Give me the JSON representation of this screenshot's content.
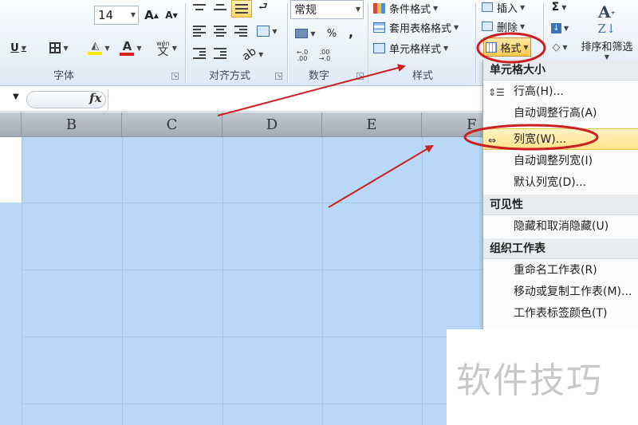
{
  "ribbon": {
    "font": {
      "size_value": "14",
      "increase_size": "A",
      "decrease_size": "A",
      "underline": "U",
      "font_color_letter": "A",
      "phonetic": "wén",
      "group_label": "字体"
    },
    "alignment": {
      "group_label": "对齐方式"
    },
    "number": {
      "format_value": "常规",
      "percent": "%",
      "comma": ",",
      "group_label": "数字"
    },
    "styles": {
      "conditional_formatting": "条件格式",
      "format_as_table": "套用表格格式",
      "cell_styles": "单元格样式",
      "group_label": "样式"
    },
    "cells": {
      "insert": "插入",
      "delete": "删除",
      "format": "格式"
    },
    "editing": {
      "sum": "Σ",
      "sort_filter": "排序和筛选"
    }
  },
  "formula_bar": {
    "fx_label": "fx"
  },
  "sheet": {
    "columns": [
      "B",
      "C",
      "D",
      "E",
      "F"
    ]
  },
  "format_menu": {
    "sections": [
      {
        "title": "单元格大小",
        "items": [
          {
            "label": "行高(H)...",
            "icon": "row-height-icon"
          },
          {
            "label": "自动调整行高(A)",
            "icon": ""
          }
        ]
      },
      {
        "items": [
          {
            "label": "列宽(W)...",
            "icon": "column-width-icon",
            "highlighted": true
          },
          {
            "label": "自动调整列宽(I)",
            "icon": ""
          },
          {
            "label": "默认列宽(D)...",
            "icon": ""
          }
        ]
      },
      {
        "title": "可见性",
        "items": [
          {
            "label": "隐藏和取消隐藏(U)",
            "icon": ""
          }
        ]
      },
      {
        "title": "组织工作表",
        "items": [
          {
            "label": "重命名工作表(R)",
            "icon": ""
          },
          {
            "label": "移动或复制工作表(M)...",
            "icon": ""
          },
          {
            "label": "工作表标签颜色(T)",
            "icon": ""
          }
        ]
      }
    ]
  },
  "watermark": "软件技巧",
  "colors": {
    "selection": "#b9d8f8",
    "annotation_red": "#cc1f1f",
    "menu_highlight": "#ffe38a",
    "font_color_bar": "#d9201a",
    "fill_color_bar": "#ffe600"
  }
}
